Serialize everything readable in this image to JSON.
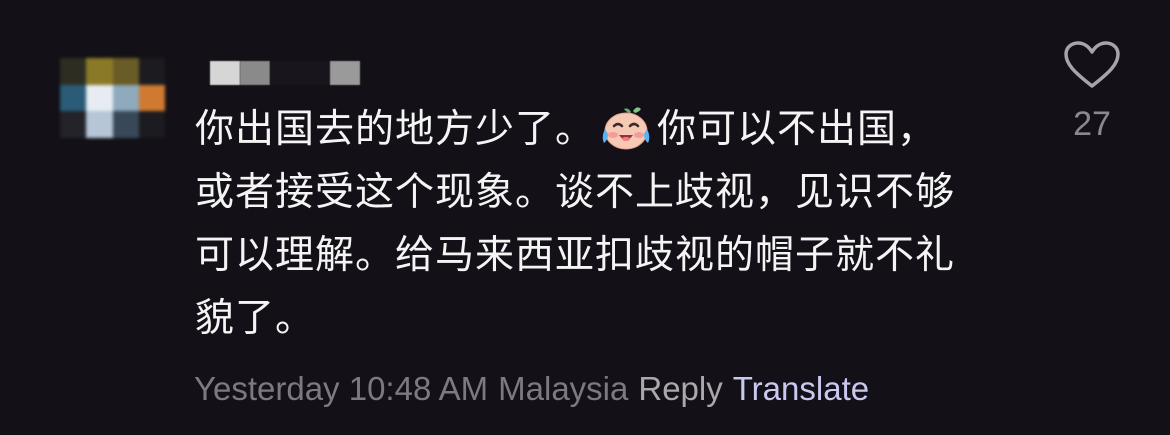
{
  "comment": {
    "avatar_colors": [
      "#3a3a2a",
      "#8a7a28",
      "#6a5e28",
      "#2a2a2a",
      "#2a5c78",
      "#e8eef4",
      "#9ab4c8",
      "#d07a30",
      "#2a2a2a",
      "#b8c8d8",
      "#3a4a5a",
      "#1f1f24"
    ],
    "username_blocks": [
      "#cfcfcf",
      "#8d8d8d",
      "#1c1a20",
      "#9a9a9a"
    ],
    "text_lines": [
      "你出国去的地方少了。",
      "你可以不出国，",
      "或者接受这个现象。谈不上歧视，见识不够",
      "可以理解。给马来西亚扣歧视的帽子就不礼",
      "貌了。"
    ],
    "emoji_name": "crying-laughing-baby-emoji",
    "time": "Yesterday 10:48 AM",
    "location": "Malaysia",
    "reply_label": "Reply",
    "translate_label": "Translate",
    "like_icon": "heart-outline-icon",
    "like_count": "27"
  }
}
